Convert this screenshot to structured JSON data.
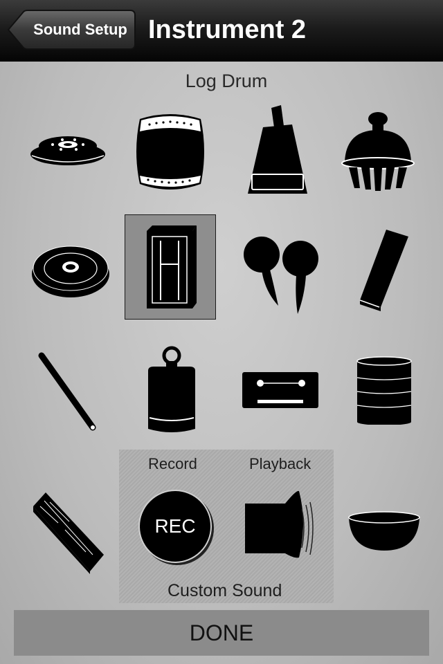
{
  "navbar": {
    "back_label": "Sound Setup",
    "title": "Instrument 2"
  },
  "selected_instrument": "Log Drum",
  "custom_sound": {
    "record_label": "Record",
    "playback_label": "Playback",
    "rec_label": "REC",
    "title": "Custom Sound"
  },
  "done_label": "DONE",
  "instrument_icons": [
    "bell-plate-icon",
    "barrel-drum-icon",
    "cowbell-icon",
    "shaker-dome-icon",
    "disc-cymbal-icon",
    "log-drum-icon",
    "maracas-icon",
    "wood-block-icon",
    "drum-stick-icon",
    "weight-bell-icon",
    "cassette-block-icon",
    "tin-can-icon",
    "plank-icon",
    "bowl-icon"
  ]
}
